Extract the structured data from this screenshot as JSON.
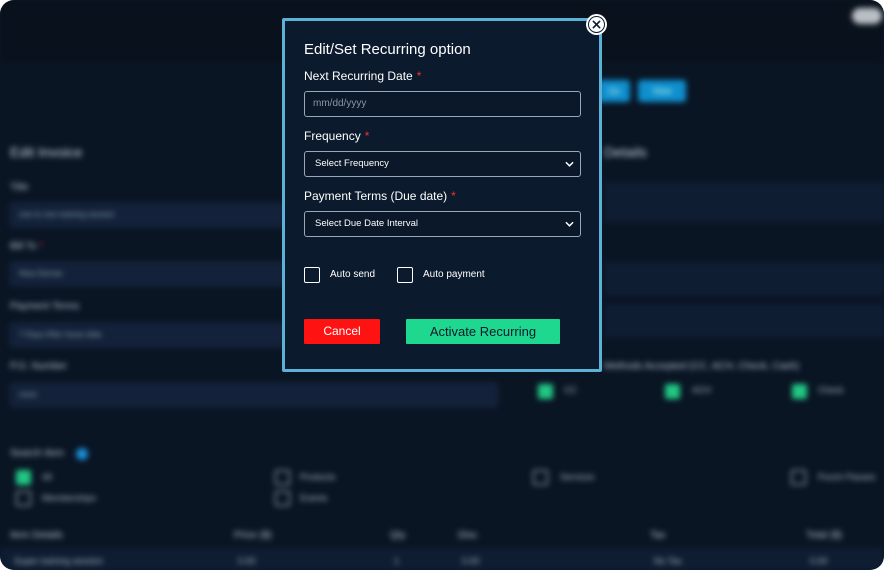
{
  "background": {
    "top_buttons": [
      "Go",
      "View"
    ],
    "left_heading": "Edit Invoice",
    "right_heading": "Details",
    "fields": [
      {
        "label": "Title",
        "value": "one to one training session",
        "required": false
      },
      {
        "label": "Bill To",
        "value": "Nisa Demas",
        "required": true
      },
      {
        "label": "Payment Terms",
        "value": "7 Days After Issue date",
        "required": false
      },
      {
        "label": "P.O. Number",
        "value": "none",
        "required": false
      }
    ],
    "payment_accepted_label": "Methods Accepted (CC, ACH, Check, Cash)",
    "payment_methods": [
      {
        "label": "CC",
        "checked": true
      },
      {
        "label": "ACH",
        "checked": true
      },
      {
        "label": "Check",
        "checked": true
      }
    ],
    "search_item_label": "Search Item",
    "item_types": [
      {
        "label": "All",
        "checked": true
      },
      {
        "label": "Products",
        "checked": false
      },
      {
        "label": "Services",
        "checked": false
      },
      {
        "label": "Punch Passes",
        "checked": false
      },
      {
        "label": "Memberships",
        "checked": false
      },
      {
        "label": "Events",
        "checked": false
      }
    ],
    "table_headers": [
      "Item Details",
      "Price ($)",
      "Qty",
      "Disc",
      "Tax",
      "Total ($)"
    ],
    "table_row": [
      "Super training session",
      "0.00",
      "1",
      "0.00",
      "No Tax",
      "0.00"
    ],
    "colors": {
      "page_bg": "#0a1524",
      "accent_green": "#21c783",
      "accent_blue": "#0f8fce"
    }
  },
  "modal": {
    "title": "Edit/Set Recurring option",
    "next_date": {
      "label": "Next Recurring Date",
      "required": true,
      "placeholder": "mm/dd/yyyy",
      "value": ""
    },
    "frequency": {
      "label": "Frequency",
      "required": true,
      "selected": "Select Frequency"
    },
    "payment_terms": {
      "label": "Payment Terms (Due date)",
      "required": true,
      "selected": "Select Due Date Interval"
    },
    "auto_send": {
      "label": "Auto send",
      "checked": false
    },
    "auto_payment": {
      "label": "Auto payment",
      "checked": false
    },
    "cancel_label": "Cancel",
    "activate_label": "Activate Recurring",
    "close_icon": "close-circle-icon",
    "colors": {
      "border": "#5cb2d6",
      "cancel": "#ff1212",
      "activate": "#1ed88f",
      "required_star": "#ff2c2c"
    }
  }
}
